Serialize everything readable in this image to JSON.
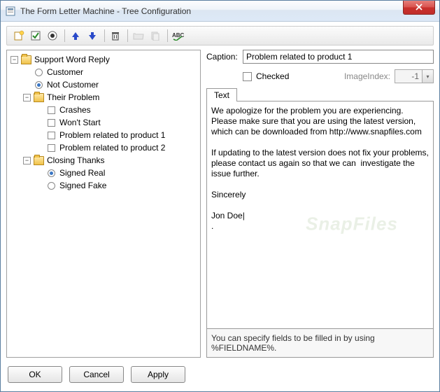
{
  "window": {
    "title": "The Form Letter Machine - Tree Configuration"
  },
  "toolbar": {
    "items": [
      "new",
      "checkbox",
      "radio",
      "sep",
      "up",
      "down",
      "sep",
      "delete",
      "sep",
      "open",
      "copy",
      "sep",
      "spellcheck"
    ]
  },
  "tree": {
    "root": {
      "label": "Support Word Reply",
      "children": [
        {
          "type": "radio",
          "label": "Customer",
          "checked": false
        },
        {
          "type": "radio",
          "label": "Not Customer",
          "checked": true
        },
        {
          "type": "folder",
          "label": "Their Problem",
          "children": [
            {
              "type": "check",
              "label": "Crashes"
            },
            {
              "type": "check",
              "label": "Won't Start"
            },
            {
              "type": "check",
              "label": "Problem related to product 1"
            },
            {
              "type": "check",
              "label": "Problem related to product 2"
            }
          ]
        },
        {
          "type": "folder",
          "label": "Closing Thanks",
          "children": [
            {
              "type": "radio",
              "label": "Signed Real",
              "checked": true
            },
            {
              "type": "radio",
              "label": "Signed Fake",
              "checked": false
            }
          ]
        }
      ]
    }
  },
  "detail": {
    "caption_label": "Caption:",
    "caption_value": "Problem related to product 1",
    "checked_label": "Checked",
    "imageindex_label": "ImageIndex:",
    "imageindex_value": "-1",
    "tab_label": "Text",
    "text_value": "We apologize for the problem you are experiencing. Please make sure that you are using the latest version, which can be downloaded from http://www.snapfiles.com\n\nIf updating to the latest version does not fix your problems, please contact us again so that we can  investigate the issue further.\n\nSincerely\n\nJon Doe|\n.",
    "hint": "You can specify fields to be filled in by using %FIELDNAME%."
  },
  "buttons": {
    "ok": "OK",
    "cancel": "Cancel",
    "apply": "Apply"
  },
  "watermark": "SnapFiles"
}
